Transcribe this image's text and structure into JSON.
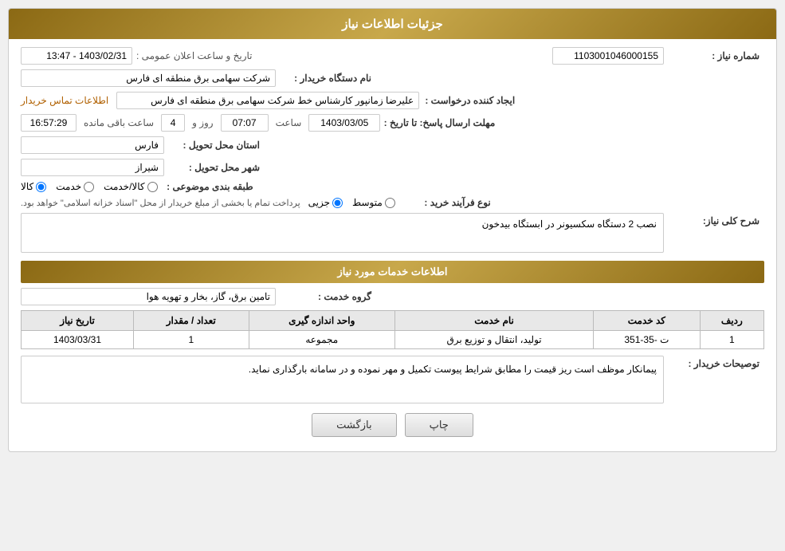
{
  "header": {
    "title": "جزئیات اطلاعات نیاز"
  },
  "fields": {
    "need_number_label": "شماره نیاز :",
    "need_number_value": "1103001046000155",
    "buyer_name_label": "نام دستگاه خریدار :",
    "buyer_name_value": "شرکت سهامی برق منطقه ای فارس",
    "creator_label": "ایجاد کننده درخواست :",
    "creator_value": "علیرضا زمانپور کارشناس خط شرکت سهامی برق منطقه ای فارس",
    "contact_link": "اطلاعات تماس خریدار",
    "reply_deadline_label": "مهلت ارسال پاسخ: تا تاریخ :",
    "reply_date": "1403/03/05",
    "reply_time_label": "ساعت",
    "reply_time": "07:07",
    "reply_days_label": "روز و",
    "reply_days": "4",
    "reply_remaining_label": "ساعت باقی مانده",
    "reply_remaining": "16:57:29",
    "province_label": "استان محل تحویل :",
    "province_value": "فارس",
    "city_label": "شهر محل تحویل :",
    "city_value": "شیراز",
    "category_label": "طبقه بندی موضوعی :",
    "category_radio_goods": "کالا",
    "category_radio_service": "خدمت",
    "category_radio_goods_service": "کالا/خدمت",
    "process_type_label": "نوع فرآیند خرید :",
    "process_radio_partial": "جزیی",
    "process_radio_medium": "متوسط",
    "process_note": "پرداخت تمام یا بخشی از مبلغ خریدار از محل \"اسناد خزانه اسلامی\" خواهد بود.",
    "need_desc_label": "شرح کلی نیاز:",
    "need_desc_value": "نصب 2 دستگاه سکسیونر در ابستگاه بیدخون",
    "services_section_label": "اطلاعات خدمات مورد نیاز",
    "service_group_label": "گروه خدمت :",
    "service_group_value": "تامین برق، گاز، بخار و تهویه هوا",
    "table": {
      "headers": [
        "ردیف",
        "کد خدمت",
        "نام خدمت",
        "واحد اندازه گیری",
        "تعداد / مقدار",
        "تاریخ نیاز"
      ],
      "rows": [
        {
          "row": "1",
          "code": "ت -35-351",
          "name": "تولید، انتقال و توزیع برق",
          "unit": "مجموعه",
          "quantity": "1",
          "date": "1403/03/31"
        }
      ]
    },
    "buyer_notes_label": "توصیحات خریدار :",
    "buyer_notes_value": "پیمانکار موظف است ریز قیمت را مطابق شرایط پیوست تکمیل و مهر نموده و در سامانه بارگذاری نماید.",
    "btn_back": "بازگشت",
    "btn_print": "چاپ",
    "public_announce_label": "تاریخ و ساعت اعلان عمومی :",
    "public_announce_value": "1403/02/31 - 13:47"
  }
}
